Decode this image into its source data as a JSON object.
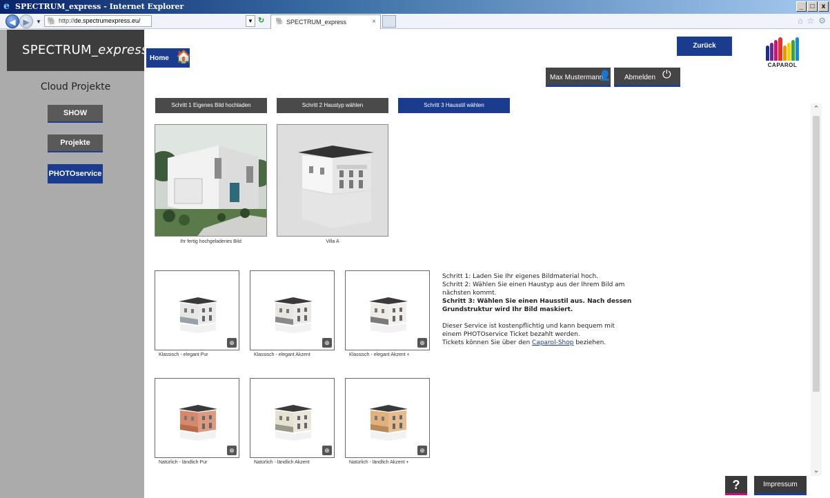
{
  "browser": {
    "title": "SPECTRUM_express - Internet Explorer",
    "url_prefix": "http://",
    "url_domain": "de.spectrumexpress.eu/",
    "tab_title": "SPECTRUM_express",
    "window_controls": [
      "_",
      "□",
      "x"
    ]
  },
  "sidebar": {
    "brand_main": "SPECTRUM_",
    "brand_italic": "express",
    "section_title": "Cloud Projekte",
    "items": [
      {
        "label": "SHOW"
      },
      {
        "label": "Projekte"
      },
      {
        "label": "PHOTOservice"
      }
    ]
  },
  "header": {
    "home_label": "Home",
    "zurueck_label": "Zurück",
    "user_label": "Max Mustermann",
    "logout_label": "Abmelden",
    "logo_text": "CAPAROL",
    "logo_colors": [
      "#1f2e8a",
      "#6a2a8e",
      "#c2187a",
      "#e8302a",
      "#f29400",
      "#f7d000",
      "#3aa63a",
      "#1a8ad0"
    ]
  },
  "steps": [
    {
      "label": "Schritt 1 Eigenes Bild hochladen"
    },
    {
      "label": "Schritt 2 Haustyp wählen"
    },
    {
      "label": "Schritt 3 Hausstil wählen"
    }
  ],
  "top_images": {
    "upload_caption": "Ihr fertig hochgeladenes Bild",
    "villa_caption": "Villa A"
  },
  "styles": [
    {
      "label": "Klassisch - elegant Pur",
      "wall": "#e6e6e6",
      "base": "#9aa0a8"
    },
    {
      "label": "Klassisch - elegant Akzent",
      "wall": "#e8e6e2",
      "base": "#8a8a8a"
    },
    {
      "label": "Klassisch - elegant Akzent +",
      "wall": "#eeece6",
      "base": "#7a7a7a"
    },
    {
      "label": "Natürlich - ländlich Pur",
      "wall": "#d6896a",
      "base": "#b86a4a"
    },
    {
      "label": "Natürlich - ländlich Akzent",
      "wall": "#e6e2d2",
      "base": "#9a9a88"
    },
    {
      "label": "Natürlich - ländlich Akzent +",
      "wall": "#e2b07a",
      "base": "#b88a5a"
    }
  ],
  "info": {
    "line1": "Schritt 1: Laden Sie Ihr eigenes Bildmaterial hoch.",
    "line2": "Schritt 2: Wählen Sie einen Haustyp aus der Ihrem Bild am nächsten kommt.",
    "line3": "Schritt 3: Wählen Sie einen Hausstil aus. Nach dessen Grundstruktur wird Ihr Bild maskiert.",
    "line4": "Dieser Service ist kostenpflichtig und kann bequem mit einem PHOTOservice Ticket bezahlt werden.",
    "line5_pre": "Tickets können Sie über den ",
    "line5_link": "Caparol-Shop",
    "line5_post": " beziehen."
  },
  "footer": {
    "help_label": "?",
    "impressum_label": "Impressum"
  }
}
